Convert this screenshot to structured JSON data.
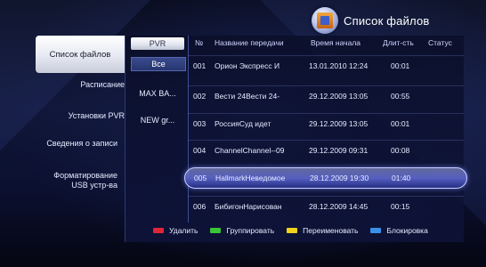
{
  "title": {
    "text": "Список файлов",
    "icon": "file-list-icon"
  },
  "left_menu": {
    "items": [
      {
        "label": "Список файлов"
      },
      {
        "label": "Расписание"
      },
      {
        "label": "Установки PVR"
      },
      {
        "label": "Сведения  о записи"
      },
      {
        "label": "Форматирование USB устр-ва"
      }
    ]
  },
  "groups": {
    "header": "PVR",
    "items": [
      {
        "label": "Все"
      },
      {
        "label": "MAX BA..."
      },
      {
        "label": "NEW gr..."
      }
    ]
  },
  "table": {
    "columns": [
      "№",
      "Название передачи",
      "Время начала",
      "Длит-сть",
      "Статус"
    ],
    "rows": [
      {
        "num": "001",
        "name": "Орион Экспресс И",
        "start": "13.01.2010 12:24",
        "duration": "00:01",
        "status": ""
      },
      {
        "num": "002",
        "name": "Вести 24Вести 24-",
        "start": "29.12.2009 13:05",
        "duration": "00:55",
        "status": ""
      },
      {
        "num": "003",
        "name": "РоссияСуд идет",
        "start": "29.12.2009 13:05",
        "duration": "00:01",
        "status": ""
      },
      {
        "num": "004",
        "name": "ChannelChannel--09",
        "start": "29.12.2009 09:31",
        "duration": "00:08",
        "status": ""
      },
      {
        "num": "005",
        "name": "HallmarkНеведомое",
        "start": "28.12.2009 19:30",
        "duration": "01:40",
        "status": ""
      },
      {
        "num": "006",
        "name": "БибигонНарисован",
        "start": "28.12.2009 14:45",
        "duration": "00:15",
        "status": ""
      }
    ],
    "selected_index": 4
  },
  "footer": {
    "keys": [
      {
        "label": "Удалить",
        "color": "#e0243a"
      },
      {
        "label": "Группировать",
        "color": "#39c43a"
      },
      {
        "label": "Переименовать",
        "color": "#f0d21c"
      },
      {
        "label": "Блокировка",
        "color": "#3b8fe6"
      }
    ]
  }
}
